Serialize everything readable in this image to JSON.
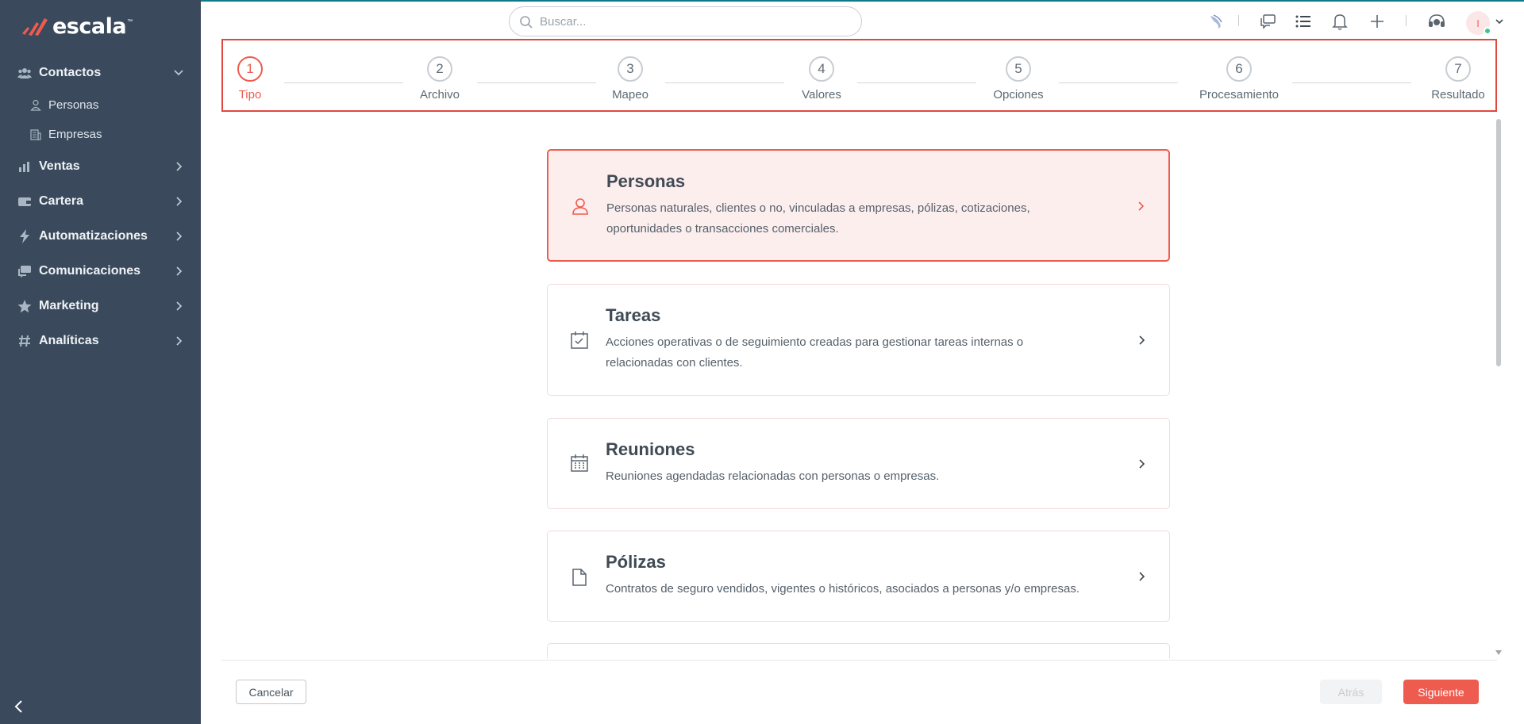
{
  "brand": {
    "name": "escala",
    "trademark": "™",
    "accent": "#ee5b4f",
    "sidebar_bg": "#3a4a5c"
  },
  "sidebar": {
    "items": [
      {
        "label": "Contactos",
        "icon": "users-icon",
        "expanded": true
      },
      {
        "label": "Ventas",
        "icon": "chart-icon"
      },
      {
        "label": "Cartera",
        "icon": "wallet-icon"
      },
      {
        "label": "Automatizaciones",
        "icon": "bolt-icon"
      },
      {
        "label": "Comunicaciones",
        "icon": "chat-icon"
      },
      {
        "label": "Marketing",
        "icon": "star-icon"
      },
      {
        "label": "Analíticas",
        "icon": "hash-icon"
      }
    ],
    "subitems": [
      {
        "label": "Personas",
        "icon": "person-icon"
      },
      {
        "label": "Empresas",
        "icon": "building-icon"
      }
    ]
  },
  "header": {
    "search_placeholder": "Buscar...",
    "avatar_initial": "I",
    "icons": [
      "bird-icon",
      "chat-bubbles-icon",
      "list-icon",
      "bell-icon",
      "plus-icon",
      "headset-icon"
    ]
  },
  "stepper": {
    "steps": [
      {
        "number": "1",
        "label": "Tipo",
        "active": true
      },
      {
        "number": "2",
        "label": "Archivo"
      },
      {
        "number": "3",
        "label": "Mapeo"
      },
      {
        "number": "4",
        "label": "Valores"
      },
      {
        "number": "5",
        "label": "Opciones"
      },
      {
        "number": "6",
        "label": "Procesamiento"
      },
      {
        "number": "7",
        "label": "Resultado"
      }
    ]
  },
  "cards": [
    {
      "title": "Personas",
      "description": "Personas naturales, clientes o no, vinculadas a empresas, pólizas, cotizaciones, oportunidades o transacciones comerciales.",
      "icon": "person-icon",
      "selected": true
    },
    {
      "title": "Tareas",
      "description": "Acciones operativas o de seguimiento creadas para gestionar tareas internas o relacionadas con clientes.",
      "icon": "calendar-check-icon"
    },
    {
      "title": "Reuniones",
      "description": "Reuniones agendadas relacionadas con personas o empresas.",
      "icon": "calendar-icon"
    },
    {
      "title": "Pólizas",
      "description": "Contratos de seguro vendidos, vigentes o históricos, asociados a personas y/o empresas.",
      "icon": "document-icon"
    }
  ],
  "footer": {
    "cancel_label": "Cancelar",
    "back_label": "Atrás",
    "next_label": "Siguiente"
  }
}
